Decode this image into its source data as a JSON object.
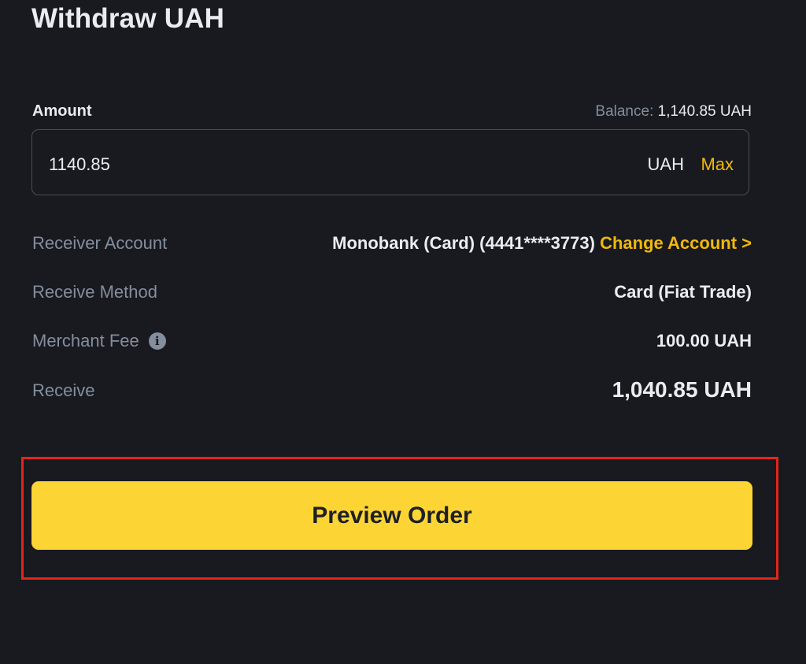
{
  "page": {
    "title": "Withdraw UAH"
  },
  "amount": {
    "label": "Amount",
    "balance_label": "Balance:",
    "balance_value": "1,140.85 UAH",
    "value": "1140.85",
    "currency": "UAH",
    "max_label": "Max"
  },
  "details": {
    "receiver_account": {
      "label": "Receiver Account",
      "value": "Monobank (Card) (4441****3773)",
      "link": "Change Account >"
    },
    "receive_method": {
      "label": "Receive Method",
      "value": "Card (Fiat Trade)"
    },
    "merchant_fee": {
      "label": "Merchant Fee",
      "icon": "info-icon",
      "value": "100.00 UAH"
    },
    "receive": {
      "label": "Receive",
      "value": "1,040.85 UAH"
    }
  },
  "action": {
    "preview_label": "Preview Order"
  },
  "colors": {
    "background": "#181a20",
    "accent": "#f0b90b",
    "button": "#fcd535",
    "highlight": "#e3251b",
    "muted": "#848e9c"
  }
}
